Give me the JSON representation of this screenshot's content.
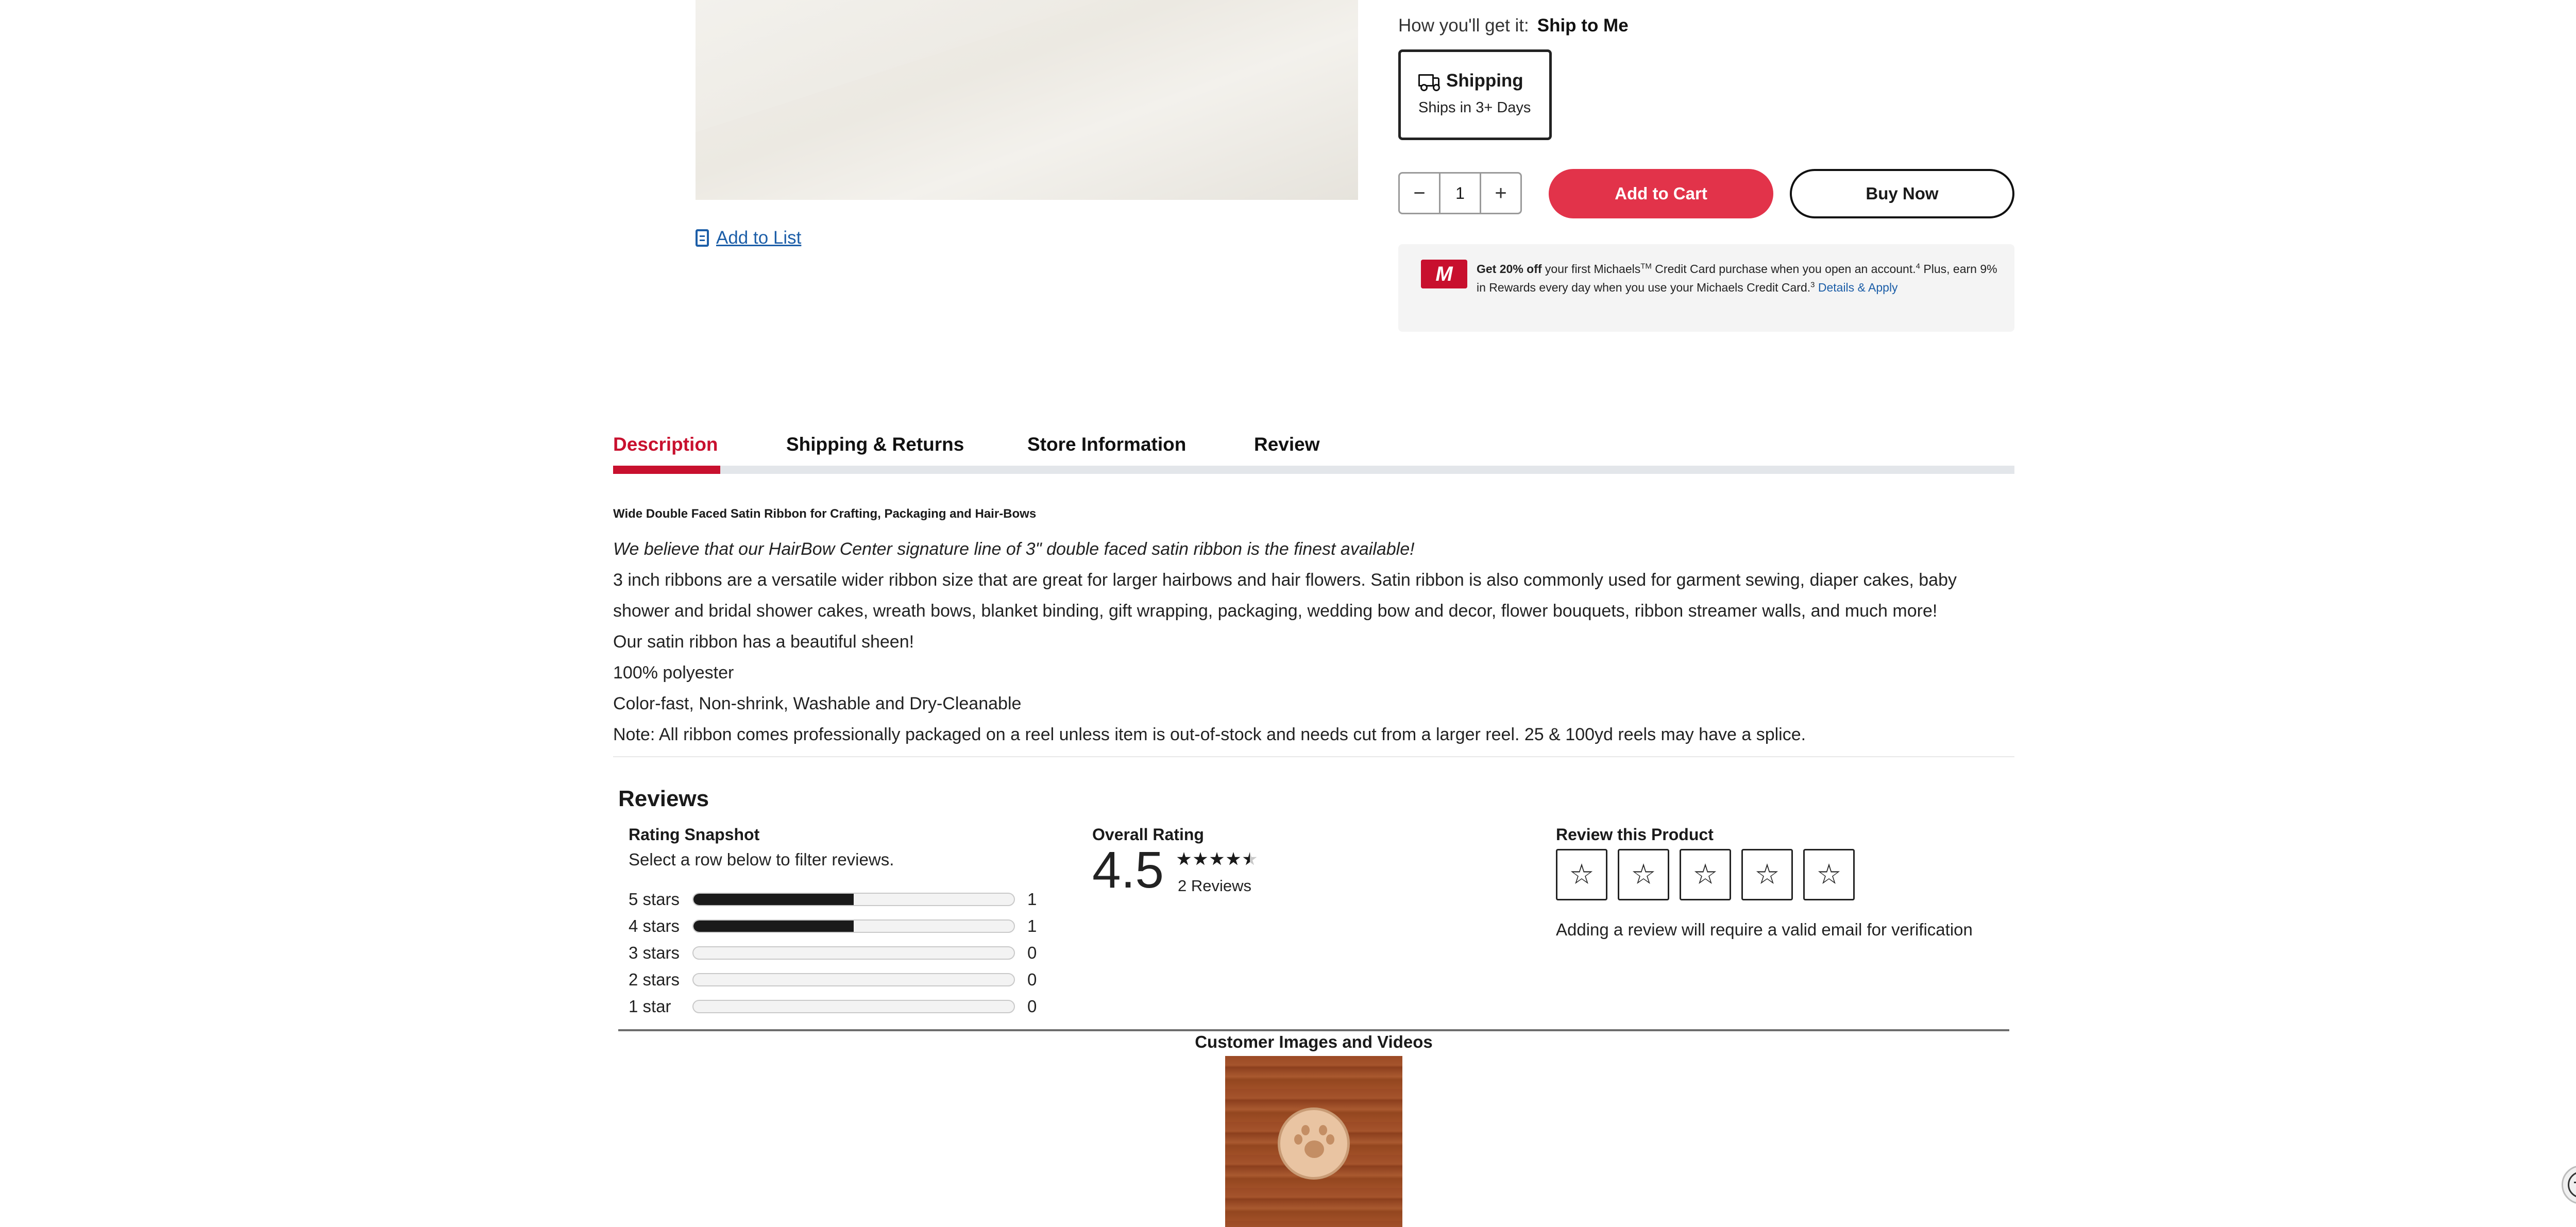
{
  "product": {
    "add_to_list": "Add to List"
  },
  "fulfillment": {
    "how_label": "How you'll get it:",
    "how_value": "Ship to Me",
    "card_title": "Shipping",
    "card_sub": "Ships in 3+ Days"
  },
  "purchase": {
    "quantity": "1",
    "minus_icon": "minus-icon",
    "plus_icon": "plus-icon",
    "add_to_cart": "Add to Cart",
    "buy_now": "Buy Now"
  },
  "promo": {
    "card_letter": "M",
    "bold": "Get 20% off",
    "text1": " your first Michaels",
    "tm": "TM",
    "text2": " Credit Card purchase when you open an account.",
    "sup1": "4",
    "text3": " Plus, earn 9% in Rewards every day when you use your Michaels Credit Card.",
    "sup2": "3",
    "link": "Details & Apply"
  },
  "tabs": [
    {
      "label": "Description",
      "active": true
    },
    {
      "label": "Shipping & Returns",
      "active": false
    },
    {
      "label": "Store Information",
      "active": false
    },
    {
      "label": "Review",
      "active": false
    }
  ],
  "description": {
    "heading": "Wide Double Faced Satin Ribbon for Crafting, Packaging and Hair-Bows",
    "paragraphs": [
      "We believe that our HairBow Center signature line of 3\" double faced satin ribbon is the finest available!",
      "3 inch ribbons are a versatile wider ribbon size that are great for larger hairbows and hair flowers. Satin ribbon is also commonly used for garment sewing, diaper cakes, baby shower and bridal shower cakes, wreath bows, blanket binding, gift wrapping, packaging, wedding bow and decor, flower bouquets, ribbon streamer walls, and much more!",
      "Our satin ribbon has a beautiful sheen!",
      "100% polyester",
      "Color-fast, Non-shrink, Washable and Dry-Cleanable",
      "Note: All ribbon comes professionally packaged on a reel unless item is out-of-stock and needs cut from a larger reel. 25 & 100yd reels may have a splice."
    ]
  },
  "reviews": {
    "title": "Reviews",
    "snapshot_title": "Rating Snapshot",
    "snapshot_sub": "Select a row below to filter reviews.",
    "rows": [
      {
        "label": "5 stars",
        "count": "1",
        "fraction": 0.5
      },
      {
        "label": "4 stars",
        "count": "1",
        "fraction": 0.5
      },
      {
        "label": "3 stars",
        "count": "0",
        "fraction": 0
      },
      {
        "label": "2 stars",
        "count": "0",
        "fraction": 0
      },
      {
        "label": "1 star",
        "count": "0",
        "fraction": 0
      }
    ],
    "overall_title": "Overall Rating",
    "overall_value": "4.5",
    "overall_stars": 4.5,
    "review_count": "2 Reviews",
    "write_title": "Review this Product",
    "write_note": "Adding a review will require a valid email for verification",
    "customer_media_title": "Customer Images and Videos"
  },
  "colors": {
    "accent_red": "#c8102e",
    "cart_button": "#e2334a",
    "link_blue": "#1c5ea8"
  }
}
